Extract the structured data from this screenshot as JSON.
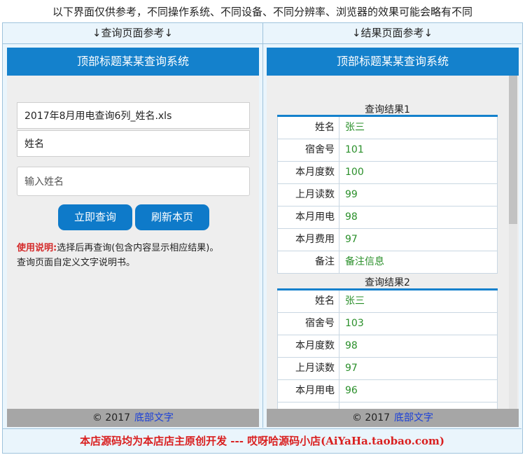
{
  "top_note": "以下界面仅供参考，不同操作系统、不同设备、不同分辨率、浏览器的效果可能会略有不同",
  "columns": {
    "left_heading": "↓查询页面参考↓",
    "right_heading": "↓结果页面参考↓"
  },
  "query_page": {
    "title": "顶部标题某某查询系统",
    "file_field_value": "2017年8月用电查询6列_姓名.xls",
    "key_field_value": "姓名",
    "name_input_placeholder": "输入姓名",
    "query_button": "立即查询",
    "refresh_button": "刷新本页",
    "help_label": "使用说明:",
    "help_text_1": "选择后再查询(包含内容显示相应结果)。",
    "help_text_2": "查询页面自定义文字说明书。",
    "footer_copyright": "© 2017",
    "footer_link": "底部文字"
  },
  "result_page": {
    "title": "顶部标题某某查询系统",
    "results": [
      {
        "heading": "查询结果1",
        "rows": [
          {
            "k": "姓名",
            "v": "张三"
          },
          {
            "k": "宿舍号",
            "v": "101"
          },
          {
            "k": "本月度数",
            "v": "100"
          },
          {
            "k": "上月读数",
            "v": "99"
          },
          {
            "k": "本月用电",
            "v": "98"
          },
          {
            "k": "本月费用",
            "v": "97"
          },
          {
            "k": "备注",
            "v": "备注信息"
          }
        ]
      },
      {
        "heading": "查询结果2",
        "rows": [
          {
            "k": "姓名",
            "v": "张三"
          },
          {
            "k": "宿舍号",
            "v": "103"
          },
          {
            "k": "本月度数",
            "v": "98"
          },
          {
            "k": "上月读数",
            "v": "97"
          },
          {
            "k": "本月用电",
            "v": "96"
          }
        ]
      }
    ],
    "footer_copyright": "© 2017",
    "footer_link": "底部文字"
  },
  "bottom_note": "本店源码均为本店店主原创开发 --- 哎呀哈源码小店(AiYaHa.taobao.com)",
  "colors": {
    "accent": "#1481cc",
    "button": "#0e7ac9",
    "value_green": "#2a8f2a",
    "warning_red": "#d91f1f"
  }
}
